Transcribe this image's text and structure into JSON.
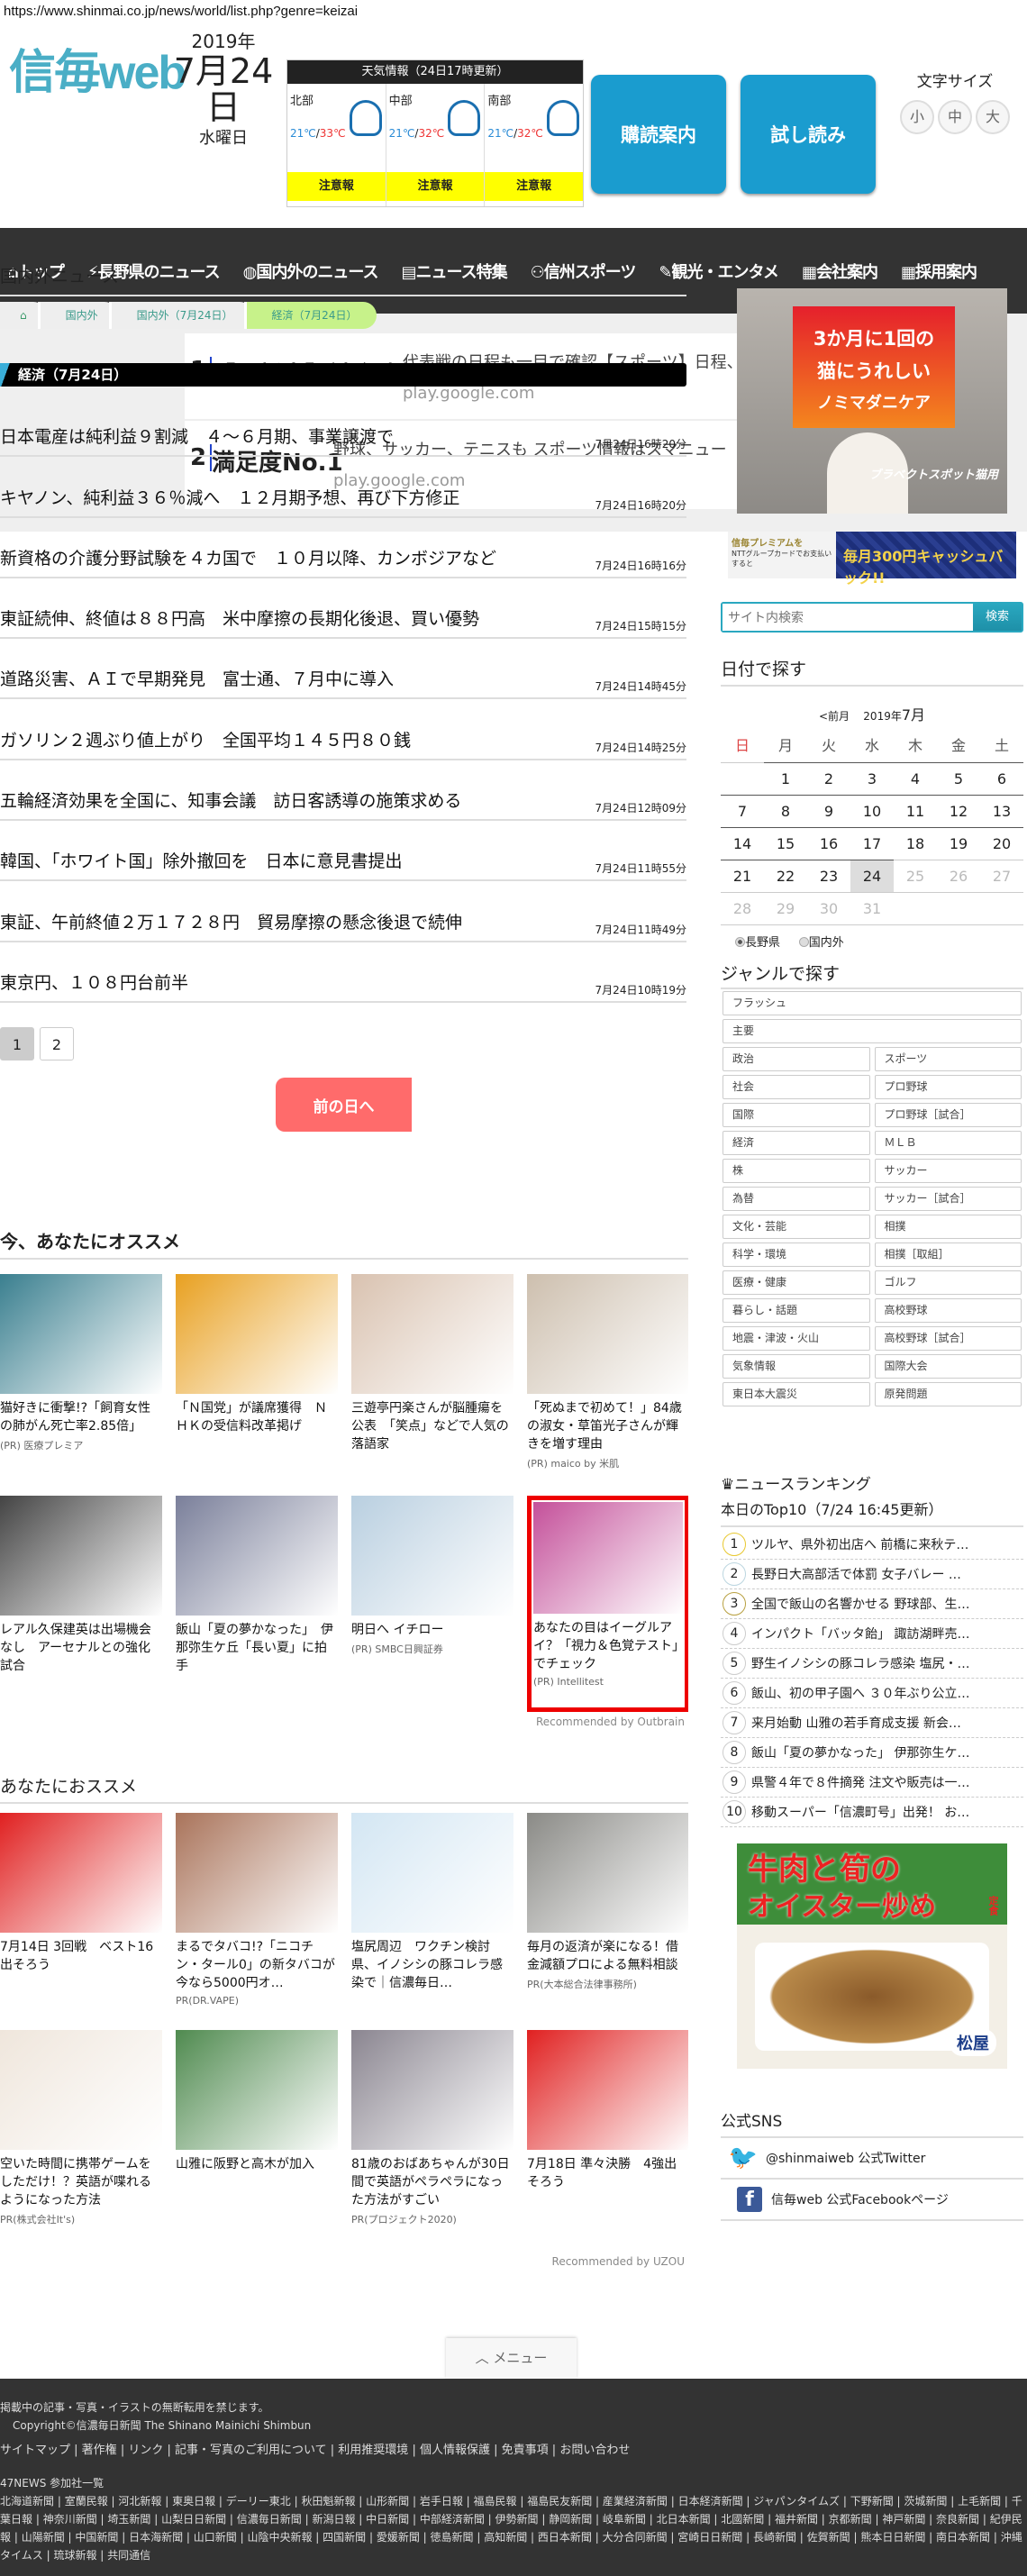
{
  "url": "https://www.shinmai.co.jp/news/world/list.php?genre=keizai",
  "header": {
    "logo": "信毎web",
    "year": "2019年",
    "date": "7月24日",
    "weekday": "水曜日",
    "weather": {
      "title": "天気情報（24日17時更新）",
      "regions": [
        {
          "name": "北部",
          "low": "21℃",
          "high": "33℃",
          "alert": "注意報"
        },
        {
          "name": "中部",
          "low": "21℃",
          "high": "32℃",
          "alert": "注意報"
        },
        {
          "name": "南部",
          "low": "21℃",
          "high": "32℃",
          "alert": "注意報"
        }
      ]
    },
    "subscribe": "購読案内",
    "trial": "試し読み",
    "font_size_label": "文字サイズ",
    "font_sizes": [
      "小",
      "中",
      "大"
    ]
  },
  "nav": [
    "トップ",
    "長野県のニュース",
    "国内外のニュース",
    "ニュース特集",
    "信州スポーツ",
    "観光・エンタメ",
    "会社案内",
    "採用案内"
  ],
  "top_ad": [
    {
      "num": "1",
      "title": "【更新中】試合速報",
      "desc": "代表戦の日程も一目で確認【スポーツ】日程、結果",
      "url": "play.google.com"
    },
    {
      "num": "2",
      "title": "満足度No.1",
      "desc": "野球、サッカー、テニスも スポーツ情報はスマニュー",
      "url": "play.google.com"
    }
  ],
  "main": {
    "title": "国内外ニュース",
    "breadcrumb": [
      "国内外",
      "国内外（7月24日）",
      "経済（7月24日）"
    ],
    "section": "経済（7月24日）",
    "news": [
      {
        "title": "日本電産は純利益９割減　４～６月期、事業譲渡で",
        "time": "7月24日16時20分"
      },
      {
        "title": "キヤノン、純利益３６％減へ　１２月期予想、再び下方修正",
        "time": "7月24日16時20分"
      },
      {
        "title": "新資格の介護分野試験を４カ国で　１０月以降、カンボジアなど",
        "time": "7月24日16時16分"
      },
      {
        "title": "東証続伸、終値は８８円高　米中摩擦の長期化後退、買い優勢",
        "time": "7月24日15時15分"
      },
      {
        "title": "道路災害、ＡＩで早期発見　富士通、７月中に導入",
        "time": "7月24日14時45分"
      },
      {
        "title": "ガソリン２週ぶり値上がり　全国平均１４５円８０銭",
        "time": "7月24日14時25分"
      },
      {
        "title": "五輪経済効果を全国に、知事会議　訪日客誘導の施策求める",
        "time": "7月24日12時09分"
      },
      {
        "title": "韓国、「ホワイト国」除外撤回を　日本に意見書提出",
        "time": "7月24日11時55分"
      },
      {
        "title": "東証、午前終値２万１７２８円　貿易摩擦の懸念後退で続伸",
        "time": "7月24日11時49分"
      },
      {
        "title": "東京円、１０８円台前半",
        "time": "7月24日10時19分"
      }
    ],
    "pages": [
      "1",
      "2"
    ],
    "prev_day": "前の日へ"
  },
  "reco1": {
    "title": "今、あなたにオススメ",
    "recommended": "Recommended by Outbrain",
    "items": [
      {
        "title": "猫好きに衝撃!?「飼育女性の肺がん死亡率2.85倍」",
        "pr": "(PR) 医療プレミア",
        "color": "#3a7f8f"
      },
      {
        "title": "「Ｎ国党」が議席獲得　ＮＨＫの受信料改革掲げ",
        "pr": "",
        "color": "#e8a020"
      },
      {
        "title": "三遊亭円楽さんが脳腫瘍を公表　「笑点」などで人気の落語家",
        "pr": "",
        "color": "#d9c2b0"
      },
      {
        "title": "「死ぬまで初めて！」84歳の淑女・草笛光子さんが輝きを増す理由",
        "pr": "(PR) maico by 米肌",
        "color": "#cdbfae"
      },
      {
        "title": "レアル久保建英は出場機会なし　アーセナルとの強化試合",
        "pr": "",
        "color": "#444"
      },
      {
        "title": "飯山「夏の夢かなった」　伊那弥生ケ丘「長い夏」に拍手",
        "pr": "",
        "color": "#7a7f9a"
      },
      {
        "title": "明日へ イチロー",
        "pr": "(PR) SMBC日興証券",
        "color": "#b9cfe0"
      },
      {
        "title": "あなたの目はイーグルアイ？「視力＆色覚テスト」でチェック",
        "pr": "(PR) Intellitest",
        "color": "#c4509a"
      }
    ]
  },
  "reco2": {
    "title": "あなたにおススメ",
    "recommended": "Recommended by UZOU",
    "items": [
      {
        "title": "7月14日 3回戦　ベスト16出そろう",
        "pr": "",
        "color": "#e02020"
      },
      {
        "title": "まるでタバコ!?「ニコチン・タール0」の新タバコが今なら5000円オ…",
        "pr": "PR(DR.VAPE)",
        "color": "#a9735a"
      },
      {
        "title": "塩尻周辺　ワクチン検討　県、イノシシの豚コレラ感染で｜信濃毎日…",
        "pr": "",
        "color": "#d3e6f3"
      },
      {
        "title": "毎月の返済が楽になる！借金減額プロによる無料相談",
        "pr": "PR(大本総合法律事務所)",
        "color": "#8a8a86"
      },
      {
        "title": "空いた時間に携帯ゲームをしただけ！？英語が喋れるようになった方法",
        "pr": "PR(株式会社It's)",
        "color": "#efe6dc"
      },
      {
        "title": "山雅に阪野と高木が加入",
        "pr": "",
        "color": "#4f8a4f"
      },
      {
        "title": "81歳のおばあちゃんが30日間で英語がペラペラになった方法がすごい",
        "pr": "PR(プロジェクト2020)",
        "color": "#8a8590"
      },
      {
        "title": "7月18日 準々決勝　4強出そろう",
        "pr": "",
        "color": "#e02020"
      }
    ]
  },
  "menu_button": "メニュー",
  "sidebar": {
    "ad1": {
      "text": [
        "3か月に1回の",
        "猫にうれしい",
        "ノミマダニケア"
      ],
      "brand": "ブラベクトスポット猫用"
    },
    "ad2": {
      "left": "信毎プレミアムを",
      "sub": "NTTグループカードでお支払いすると",
      "right": "毎月300円キャッシュバック!!"
    },
    "search_placeholder": "サイト内検索",
    "search_button": "検索",
    "calendar": {
      "title": "日付で探す",
      "prev": "<前月",
      "month_year": "2019年",
      "month": "7月",
      "weekdays": [
        "日",
        "月",
        "火",
        "水",
        "木",
        "金",
        "土"
      ],
      "weeks": [
        [
          "",
          "1",
          "2",
          "3",
          "4",
          "5",
          "6"
        ],
        [
          "7",
          "8",
          "9",
          "10",
          "11",
          "12",
          "13"
        ],
        [
          "14",
          "15",
          "16",
          "17",
          "18",
          "19",
          "20"
        ],
        [
          "21",
          "22",
          "23",
          "24",
          "25",
          "26",
          "27"
        ],
        [
          "28",
          "29",
          "30",
          "31",
          "",
          "",
          ""
        ]
      ],
      "today": "24",
      "radios": [
        "長野県",
        "国内外"
      ],
      "selected_radio": "長野県"
    },
    "genre": {
      "title": "ジャンルで探す",
      "full": [
        "フラッシュ",
        "主要"
      ],
      "pairs": [
        [
          "政治",
          "スポーツ"
        ],
        [
          "社会",
          "プロ野球"
        ],
        [
          "国際",
          "プロ野球［試合］"
        ],
        [
          "経済",
          "ＭＬＢ"
        ],
        [
          "株",
          "サッカー"
        ],
        [
          "為替",
          "サッカー［試合］"
        ],
        [
          "文化・芸能",
          "相撲"
        ],
        [
          "科学・環境",
          "相撲［取組］"
        ],
        [
          "医療・健康",
          "ゴルフ"
        ],
        [
          "暮らし・話題",
          "高校野球"
        ],
        [
          "地震・津波・火山",
          "高校野球［試合］"
        ],
        [
          "気象情報",
          "国際大会"
        ],
        [
          "東日本大震災",
          "原発問題"
        ]
      ]
    },
    "ranking": {
      "title": "ニュースランキング",
      "subtitle": "本日のTop10（7/24 16:45更新）",
      "items": [
        "ツルヤ、県外初出店へ 前橋に来秋テ…",
        "長野日大高部活で体罰 女子バレー …",
        "全国で飯山の名響かせる 野球部、生…",
        "インパクト「バッタ飴」 諏訪湖畔売…",
        "野生イノシシの豚コレラ感染 塩尻・…",
        "飯山、初の甲子園へ ３０年ぶり公立…",
        "来月始動 山雅の若手育成支援 新会…",
        "飯山「夏の夢かなった」 伊那弥生ケ…",
        "県警４年で８件摘発 注文や販売は一…",
        "移動スーパー「信濃町号」出発！ お…"
      ]
    },
    "ad3": {
      "text": [
        "牛肉と筍の",
        "オイスター炒め"
      ],
      "teishoku": "定食",
      "brand": "松屋"
    },
    "sns": {
      "title": "公式SNS",
      "twitter": "@shinmaiweb 公式Twitter",
      "facebook": "信毎web 公式Facebookページ"
    }
  },
  "footer": {
    "notice": "掲載中の記事・写真・イラストの無断転用を禁じます。",
    "copyright": "Copyright©信濃毎日新聞 The Shinano Mainichi Shimbun",
    "links": [
      "サイトマップ",
      "著作権",
      "リンク",
      "記事・写真のご利用について",
      "利用推奨環境",
      "個人情報保護",
      "免責事項",
      "お問い合わせ"
    ],
    "news47_title": "47NEWS 参加社一覧",
    "news47": [
      "北海道新聞",
      "室蘭民報",
      "河北新報",
      "東奥日報",
      "デーリー東北",
      "秋田魁新報",
      "山形新聞",
      "岩手日報",
      "福島民報",
      "福島民友新聞",
      "産業経済新聞",
      "日本経済新聞",
      "ジャパンタイムズ",
      "下野新聞",
      "茨城新聞",
      "上毛新聞",
      "千葉日報",
      "神奈川新聞",
      "埼玉新聞",
      "山梨日日新聞",
      "信濃毎日新聞",
      "新潟日報",
      "中日新聞",
      "中部経済新聞",
      "伊勢新聞",
      "静岡新聞",
      "岐阜新聞",
      "北日本新聞",
      "北國新聞",
      "福井新聞",
      "京都新聞",
      "神戸新聞",
      "奈良新聞",
      "紀伊民報",
      "山陽新聞",
      "中国新聞",
      "日本海新聞",
      "山口新聞",
      "山陰中央新報",
      "四国新聞",
      "愛媛新聞",
      "徳島新聞",
      "高知新聞",
      "西日本新聞",
      "大分合同新聞",
      "宮崎日日新聞",
      "長崎新聞",
      "佐賀新聞",
      "熊本日日新聞",
      "南日本新聞",
      "沖縄タイムス",
      "琉球新報",
      "共同通信"
    ]
  }
}
